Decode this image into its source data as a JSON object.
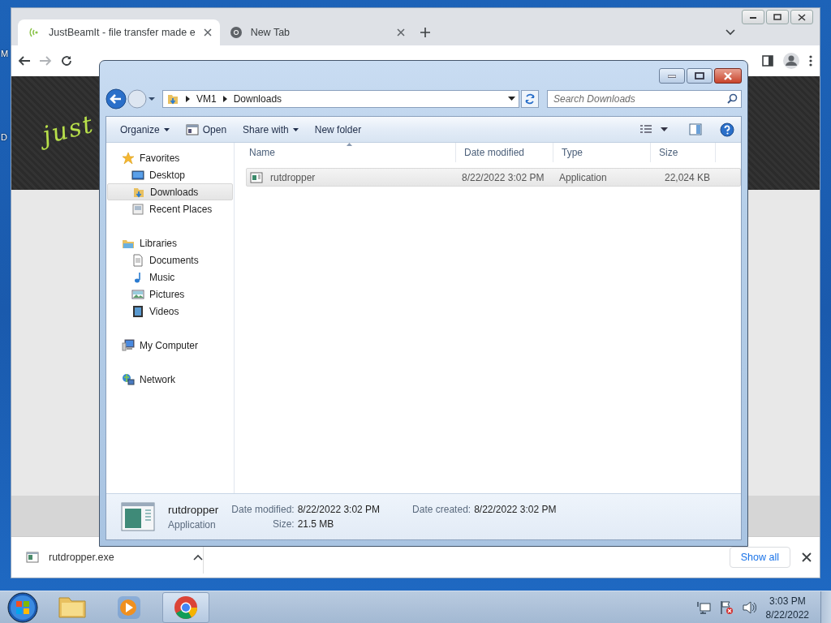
{
  "desktop": {
    "icon_labels": [
      "M",
      "D"
    ]
  },
  "browser": {
    "tabs": [
      {
        "title": "JustBeamIt - file transfer made e",
        "selected": true,
        "kind": "site"
      },
      {
        "title": "New Tab",
        "selected": false,
        "kind": "chrome"
      }
    ],
    "page_logo": "just",
    "download_bar": {
      "file": "rutdropper.exe",
      "show_all": "Show all"
    }
  },
  "explorer": {
    "path": [
      "VM1",
      "Downloads"
    ],
    "search": {
      "placeholder": "Search Downloads"
    },
    "toolbar": [
      {
        "label": "Organize",
        "dropdown": true
      },
      {
        "label": "Open",
        "dropdown": false,
        "kind": "open"
      },
      {
        "label": "Share with",
        "dropdown": true
      },
      {
        "label": "New folder",
        "dropdown": false
      }
    ],
    "nav": [
      {
        "label": "Favorites",
        "kind": "star",
        "selected": false,
        "children": [
          {
            "label": "Desktop",
            "kind": "desktop",
            "selected": false
          },
          {
            "label": "Downloads",
            "kind": "downloads",
            "selected": true
          },
          {
            "label": "Recent Places",
            "kind": "recent",
            "selected": false
          }
        ]
      },
      {
        "label": "Libraries",
        "kind": "libraries",
        "selected": false,
        "children": [
          {
            "label": "Documents",
            "kind": "documents",
            "selected": false
          },
          {
            "label": "Music",
            "kind": "music",
            "selected": false
          },
          {
            "label": "Pictures",
            "kind": "pictures",
            "selected": false
          },
          {
            "label": "Videos",
            "kind": "videos",
            "selected": false
          }
        ]
      },
      {
        "label": "My Computer",
        "kind": "computer",
        "selected": false
      },
      {
        "label": "Network",
        "kind": "network",
        "selected": false
      }
    ],
    "columns": [
      "Name",
      "Date modified",
      "Type",
      "Size"
    ],
    "rows": [
      {
        "name": "rutdropper",
        "date_modified": "8/22/2022 3:02 PM",
        "type": "Application",
        "size": "22,024 KB",
        "selected": true
      }
    ],
    "details": {
      "name": "rutdropper",
      "type": "Application",
      "fields": [
        {
          "label": "Date modified:",
          "value": "8/22/2022 3:02 PM"
        },
        {
          "label": "Date created:",
          "value": "8/22/2022 3:02 PM"
        },
        {
          "label": "Size:",
          "value": "21.5 MB"
        }
      ]
    }
  },
  "taskbar": {
    "apps": [
      {
        "kind": "explorer",
        "selected": false
      },
      {
        "kind": "media",
        "selected": false
      },
      {
        "kind": "chrome",
        "selected": true
      }
    ],
    "time": "3:03 PM",
    "date": "8/22/2022"
  }
}
